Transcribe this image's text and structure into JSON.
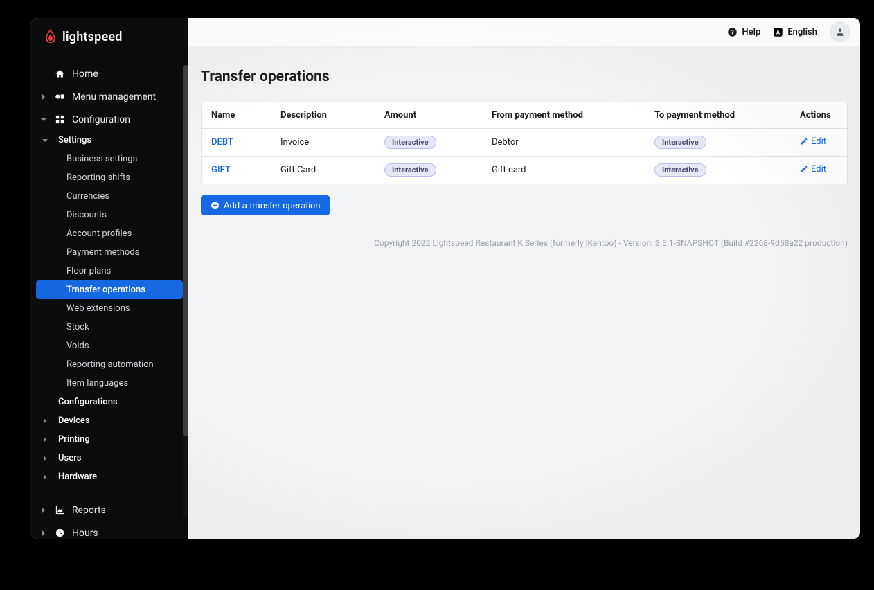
{
  "brand": "lightspeed",
  "topbar": {
    "help": "Help",
    "language": "English"
  },
  "page_title": "Transfer operations",
  "add_label": "Add a transfer operation",
  "columns": {
    "name": "Name",
    "description": "Description",
    "amount": "Amount",
    "from": "From payment method",
    "to": "To payment method",
    "actions": "Actions"
  },
  "interactive_pill": "Interactive",
  "edit_label": "Edit",
  "rows": [
    {
      "name": "DEBT",
      "description": "Invoice",
      "amount": "Interactive",
      "from": "Debtor",
      "to": "Interactive"
    },
    {
      "name": "GIFT",
      "description": "Gift Card",
      "amount": "Interactive",
      "from": "Gift card",
      "to": "Interactive"
    }
  ],
  "nav": {
    "home": "Home",
    "menu_mgmt": "Menu management",
    "configuration": "Configuration",
    "settings": "Settings",
    "business_settings": "Business settings",
    "reporting_shifts": "Reporting shifts",
    "currencies": "Currencies",
    "discounts": "Discounts",
    "account_profiles": "Account profiles",
    "payment_methods": "Payment methods",
    "floor_plans": "Floor plans",
    "transfer_operations": "Transfer operations",
    "web_extensions": "Web extensions",
    "stock": "Stock",
    "voids": "Voids",
    "reporting_automation": "Reporting automation",
    "item_languages": "Item languages",
    "configurations": "Configurations",
    "devices": "Devices",
    "printing": "Printing",
    "users": "Users",
    "hardware": "Hardware",
    "reports": "Reports",
    "hours": "Hours"
  },
  "footer": "Copyright 2022 Lightspeed Restaurant K Series (formerly iKentoo) - Version: 3.5.1-SNAPSHOT (Build #2268-9d58a22 production)"
}
